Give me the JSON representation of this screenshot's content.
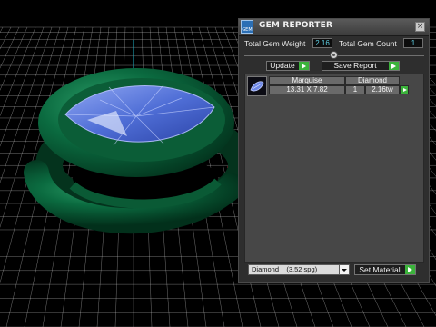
{
  "panel": {
    "title": "GEM REPORTER",
    "icon": "gem-reporter-app-icon",
    "close_icon": "close-icon",
    "total_gem_weight_label": "Total Gem Weight",
    "total_gem_weight_value": "2.16",
    "total_gem_count_label": "Total Gem Count",
    "total_gem_count_value": "1",
    "update_label": "Update",
    "save_report_label": "Save Report",
    "go_icon": "play-arrow-icon"
  },
  "gem_table": {
    "headers": [
      "Marquise",
      "Diamond"
    ],
    "rows": [
      {
        "thumbnail": "marquise-gem-icon",
        "dimensions": "13.31 X 7.82",
        "count": "1",
        "weight": "2.16tw"
      }
    ]
  },
  "material": {
    "selected": "Diamond    (3.52 spg)",
    "set_label": "Set Material"
  },
  "viewport": {
    "background": "#000000",
    "grid_color": "#d2d2d2",
    "ring_color": "#0b6b40",
    "gem_color": "#5b78d6",
    "axis_color": "#1fb3c8"
  },
  "colors": {
    "go_button": "#3bb33b",
    "value_text": "#5fd0e4",
    "panel_bg": "#2e2e2e"
  }
}
